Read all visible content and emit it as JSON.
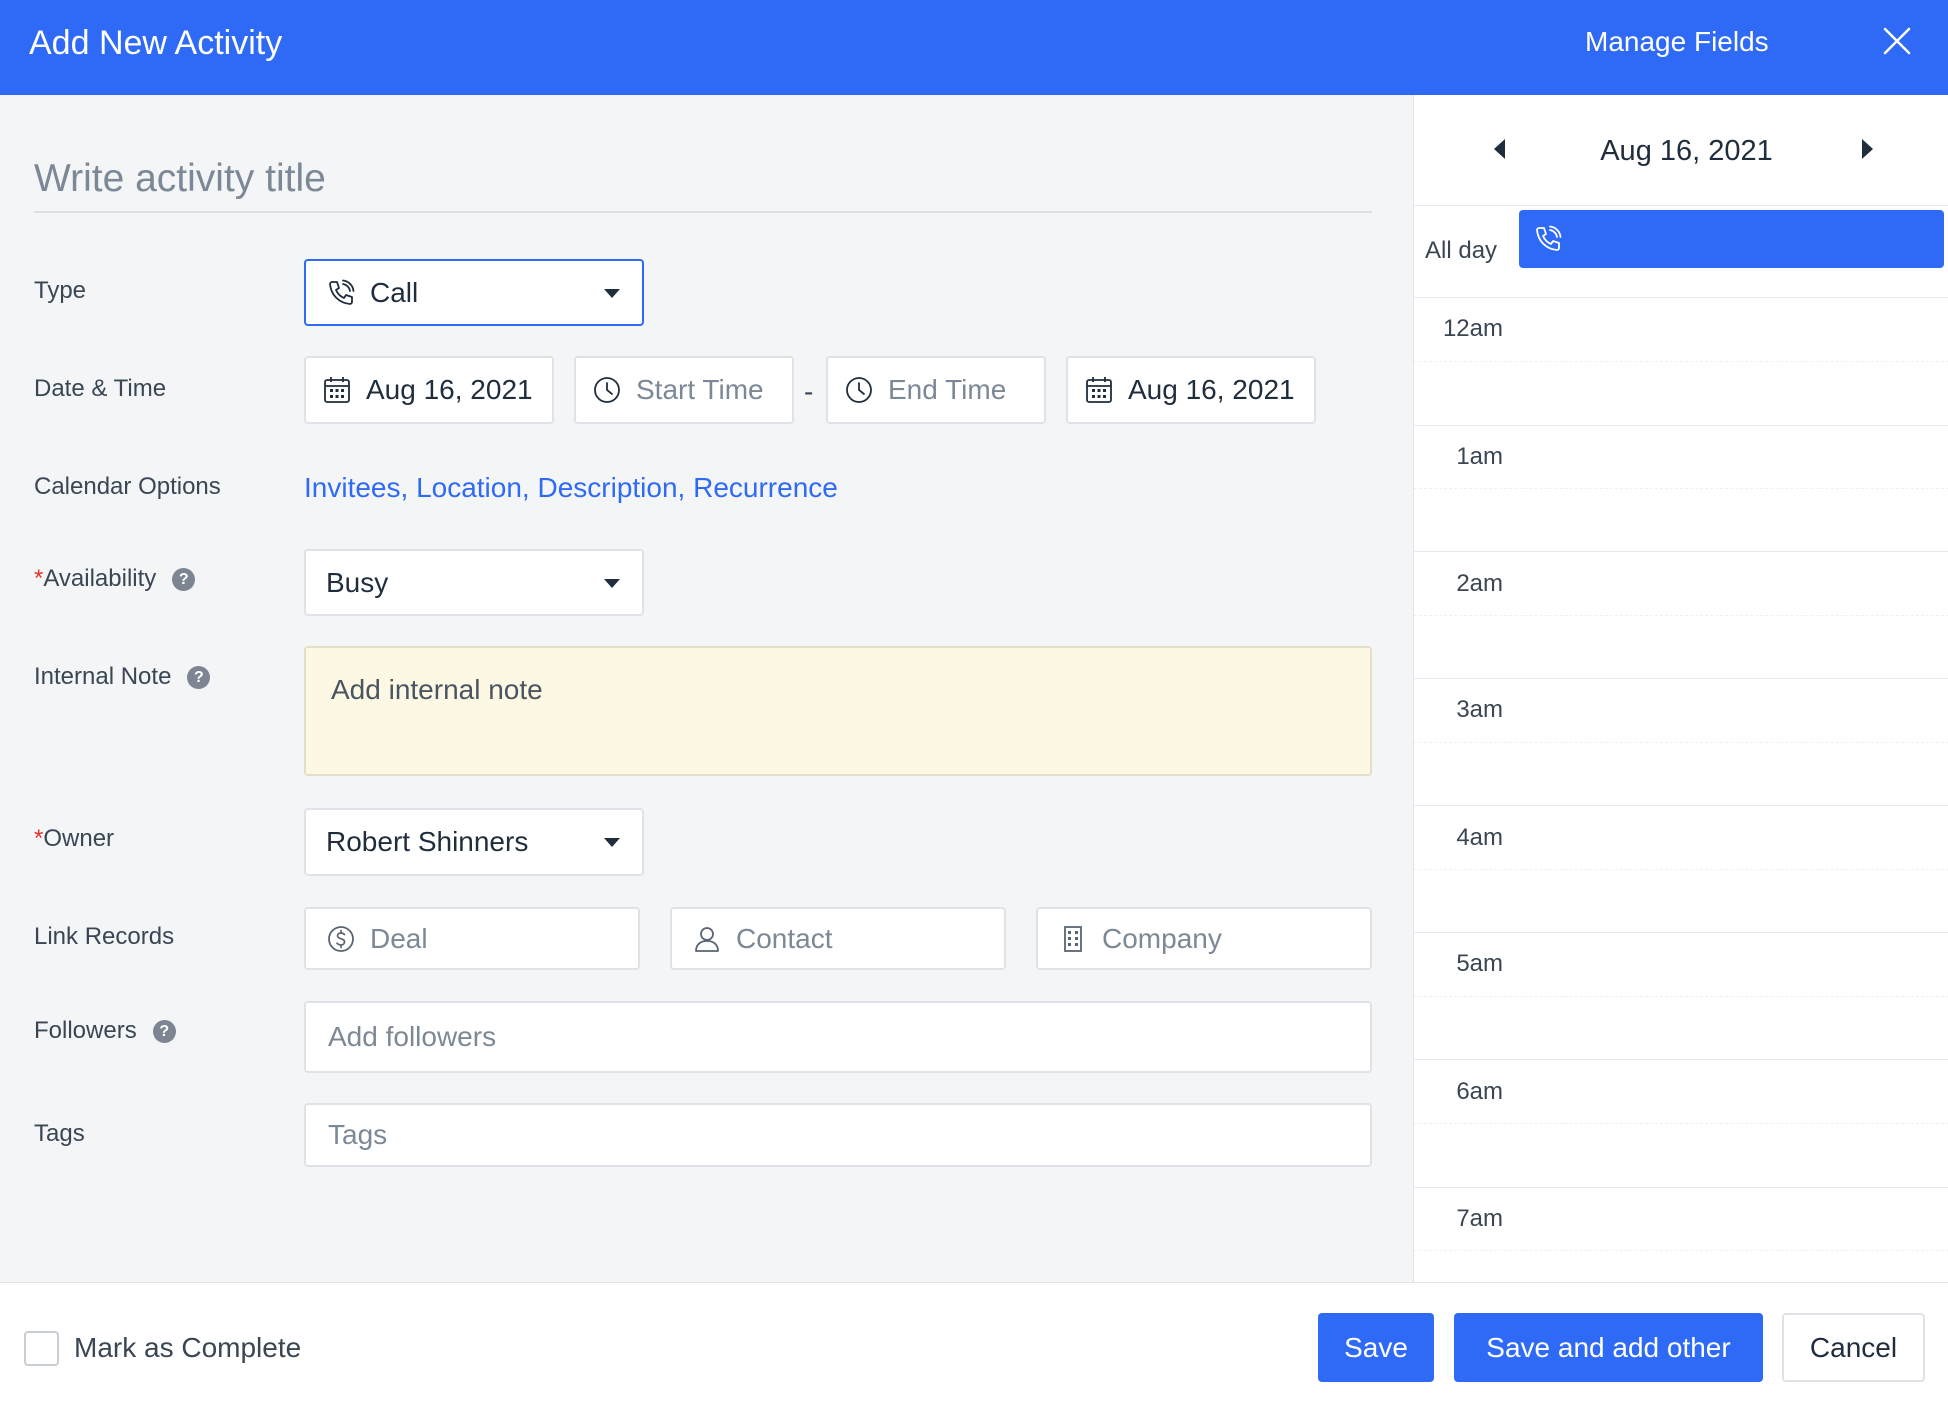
{
  "header": {
    "title": "Add New Activity",
    "manage_fields": "Manage Fields"
  },
  "form": {
    "title_placeholder": "Write activity title",
    "type": {
      "label": "Type",
      "value": "Call"
    },
    "date_time": {
      "label": "Date & Time",
      "start_date": "Aug 16, 2021",
      "start_time_placeholder": "Start Time",
      "separator": "-",
      "end_time_placeholder": "End Time",
      "end_date": "Aug 16, 2021"
    },
    "calendar_options": {
      "label": "Calendar Options",
      "links": [
        "Invitees,",
        "Location,",
        "Description,",
        "Recurrence"
      ]
    },
    "availability": {
      "required_mark": "*",
      "label": "Availability",
      "value": "Busy"
    },
    "internal_note": {
      "label": "Internal Note",
      "placeholder": "Add internal note"
    },
    "owner": {
      "required_mark": "*",
      "label": "Owner",
      "value": "Robert Shinners"
    },
    "link_records": {
      "label": "Link Records",
      "deal": "Deal",
      "contact": "Contact",
      "company": "Company"
    },
    "followers": {
      "label": "Followers",
      "placeholder": "Add followers"
    },
    "tags": {
      "label": "Tags",
      "placeholder": "Tags"
    },
    "help_glyph": "?"
  },
  "calendar": {
    "date": "Aug 16, 2021",
    "all_day_label": "All day",
    "hours": [
      "12am",
      "1am",
      "2am",
      "3am",
      "4am",
      "5am",
      "6am",
      "7am"
    ]
  },
  "footer": {
    "mark_complete": "Mark as Complete",
    "save": "Save",
    "save_and_add": "Save and add other",
    "cancel": "Cancel"
  },
  "colors": {
    "accent": "#2e6af5",
    "note_background": "#fcf8e3",
    "required": "#e5322d"
  },
  "icons": [
    "close-icon",
    "phone-icon",
    "calendar-icon",
    "clock-icon",
    "dollar-icon",
    "person-icon",
    "building-icon",
    "help-icon",
    "chevron-left-icon",
    "chevron-right-icon",
    "caret-down-icon"
  ]
}
